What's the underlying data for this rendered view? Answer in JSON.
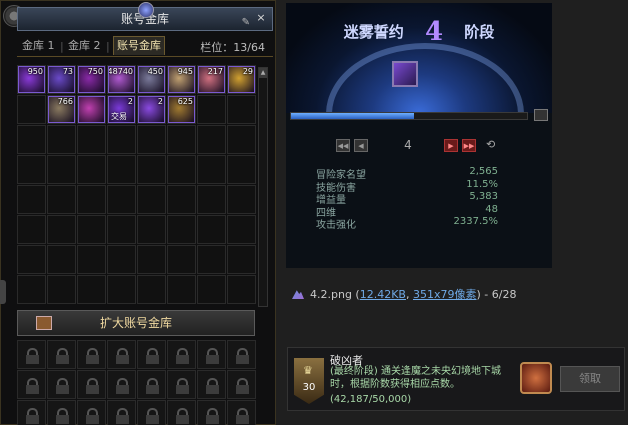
{
  "vault": {
    "title": "账号金库",
    "close_icon": "×",
    "tabs": [
      "金库 1",
      "金库 2",
      "账号金库"
    ],
    "active_tab": 2,
    "slots_text": "栏位：13/64",
    "items": [
      {
        "count": "950",
        "color": "#8a3ad8"
      },
      {
        "count": "73",
        "color": "#6a4ac8"
      },
      {
        "count": "750",
        "color": "#8a2aa8"
      },
      {
        "count": "48740",
        "color": "#b05ad0"
      },
      {
        "count": "450",
        "color": "#7a7a9a"
      },
      {
        "count": "945",
        "color": "#c0a070"
      },
      {
        "count": "217",
        "color": "#d07080"
      },
      {
        "count": "29",
        "color": "#d0a030"
      },
      {
        "count": "",
        "color": "#303030"
      },
      {
        "count": "766",
        "color": "#8a7a60"
      },
      {
        "count": "",
        "color": "#c040b0"
      },
      {
        "count": "2",
        "color": "#7a3ad8",
        "trade": "交易"
      },
      {
        "count": "2",
        "color": "#8a4ae0"
      },
      {
        "count": "625",
        "color": "#a07a30"
      }
    ],
    "expand_label": "扩大账号金库"
  },
  "stage": {
    "title_left": "迷雾誓约",
    "stage_number": "4",
    "title_right": "阶段",
    "progress_fraction": 0.52,
    "page_number": "4",
    "stats": [
      {
        "label": "冒险家名望",
        "value": "2,565"
      },
      {
        "label": "技能伤害",
        "value": "11.5%"
      },
      {
        "label": "增益量",
        "value": "5,383"
      },
      {
        "label": "四维",
        "value": "48"
      },
      {
        "label": "攻击强化",
        "value": "2337.5%"
      }
    ]
  },
  "caption": {
    "filename": "4.2.png (",
    "size": "12.42KB",
    "sep": ", ",
    "dims": "351x79像素",
    "tail": ") - 6/28"
  },
  "achievement": {
    "points": "30",
    "name": "破凶者",
    "description": "(最终阶段) 通关逢魔之未央幻境地下城时，根据阶数获得相应点数。",
    "progress": "(42,187/50,000)",
    "claim_label": "领取"
  },
  "colors": {
    "accent": "#b28aff",
    "positive": "#7fb090"
  }
}
